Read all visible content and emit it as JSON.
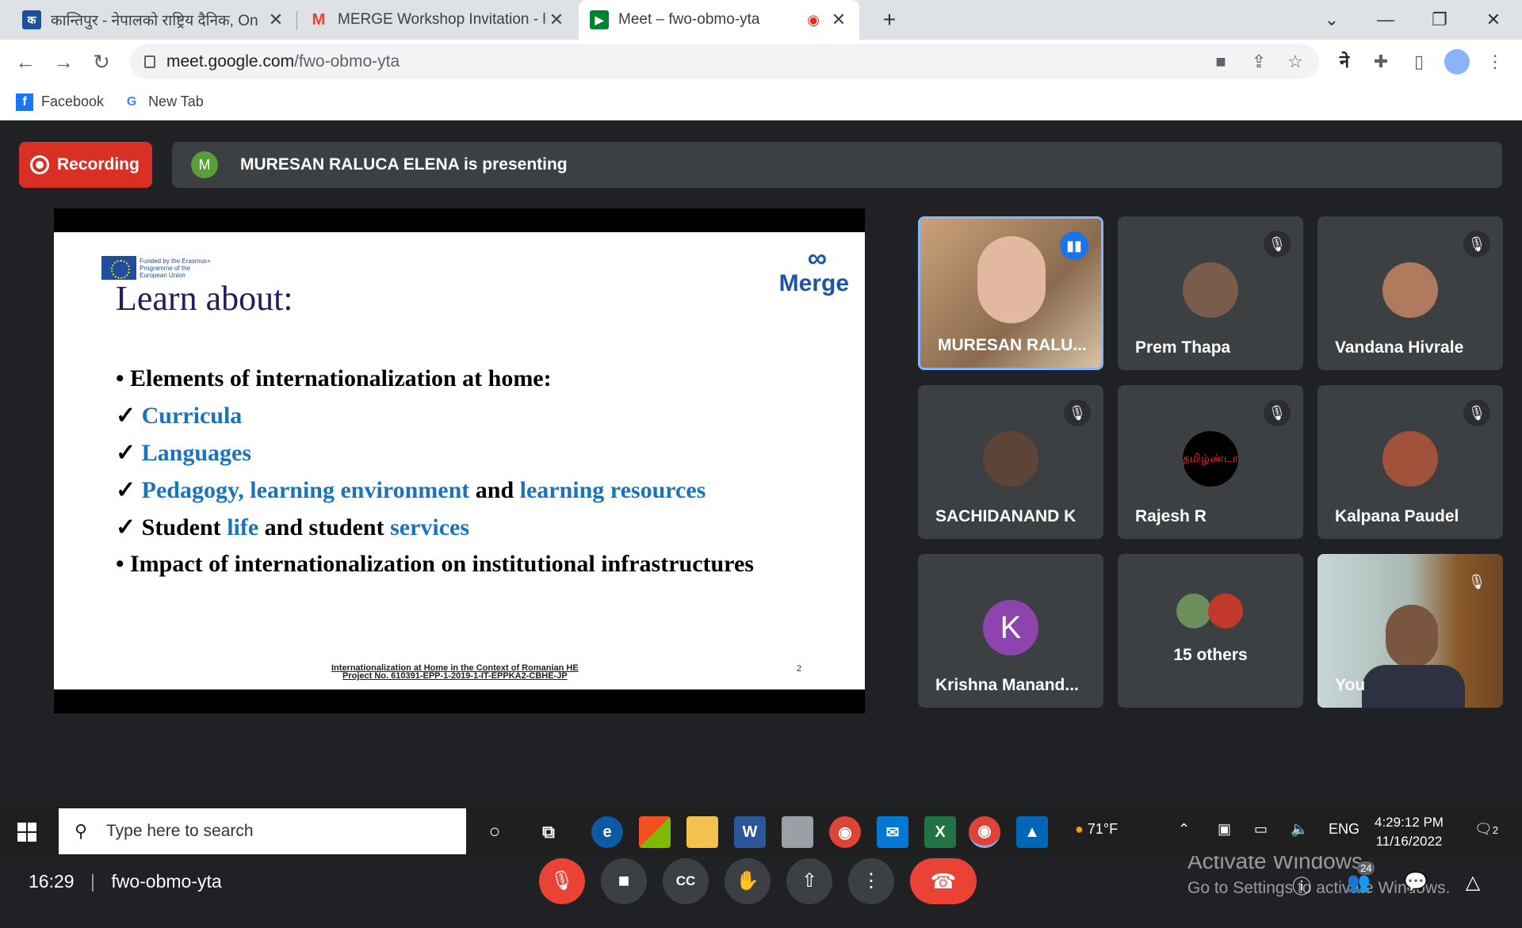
{
  "browser": {
    "tabs": [
      {
        "title": "कान्तिपुर - नेपालको राष्ट्रिय दैनिक, On",
        "favicon": "kantipur-icon"
      },
      {
        "title": "MERGE Workshop Invitation - lila",
        "favicon": "gmail-icon"
      },
      {
        "title": "Meet – fwo-obmo-yta",
        "favicon": "meet-icon"
      }
    ],
    "url_host": "meet.google.com",
    "url_path": "/fwo-obmo-yta",
    "bookmarks": [
      "Facebook",
      "New Tab"
    ]
  },
  "meet": {
    "recording_label": "Recording",
    "presenter_initial": "M",
    "presenting_text": "MURESAN RALUCA ELENA is presenting",
    "slide": {
      "eu_text": "Funded by the Erasmus+ Programme of the European Union",
      "brand": "Merge",
      "title": "Learn about:",
      "line1": "• Elements of internationalization at home:",
      "line2": "Curricula",
      "line3": "Languages",
      "line4a": "Pedagogy, learning environment",
      "line4b": " and ",
      "line4c": "learning resources",
      "line5a": "Student ",
      "line5b": "life",
      "line5c": " and student ",
      "line5d": "services",
      "line6": "•  Impact of internationalization on institutional infrastructures",
      "footer1": "Internationalization at Home in the Context of Romanian HE",
      "footer2": "Project No. 610391-EPP-1-2019-1-IT-EPPKA2-CBHE-JP",
      "page": "2",
      "check": "✓"
    },
    "participants": [
      {
        "name": "MURESAN RALU...",
        "active": true
      },
      {
        "name": "Prem Thapa"
      },
      {
        "name": "Vandana Hivrale"
      },
      {
        "name": "SACHIDANAND K"
      },
      {
        "name": "Rajesh R",
        "avatar_text": "தமிழ்ண்டா"
      },
      {
        "name": "Kalpana Paudel"
      },
      {
        "name": "Krishna Manand...",
        "initial": "K"
      },
      {
        "name": "15 others"
      },
      {
        "name": "You"
      }
    ],
    "clock": "16:29",
    "meeting_code": "fwo-obmo-yta",
    "people_count": "24",
    "watermark_title": "Activate Windows",
    "watermark_sub": "Go to Settings to activate Windows."
  },
  "taskbar": {
    "search_placeholder": "Type here to search",
    "weather": "71°F",
    "lang": "ENG",
    "time": "4:29:12 PM",
    "date": "11/16/2022",
    "notif_count": "2"
  },
  "colors": {
    "recording": "#d93025",
    "accent": "#1a73e8",
    "end_call": "#ea4335",
    "slide_blue": "#1a73bf"
  }
}
